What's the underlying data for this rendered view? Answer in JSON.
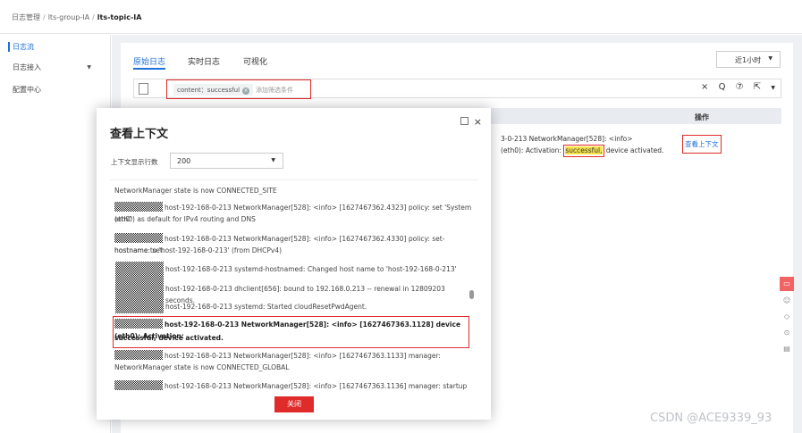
{
  "breadcrumb": {
    "c1": "日志管理",
    "c2": "lts-group-IA",
    "c3": "lts-topic-IA",
    "sep": "/"
  },
  "sidebar": {
    "items": [
      {
        "label": "日志流"
      },
      {
        "label": "日志接入"
      },
      {
        "label": "配置中心"
      }
    ]
  },
  "tabs": [
    {
      "label": "原始日志"
    },
    {
      "label": "实时日志"
    },
    {
      "label": "可视化"
    }
  ],
  "time_select": {
    "value": "近1小时"
  },
  "filter": {
    "chip": "content：successful",
    "add_placeholder": "添加筛选条件",
    "icons": {
      "clear": "×",
      "search": "Q",
      "help": "⑦",
      "export": "⇱"
    }
  },
  "table": {
    "op_header": "操作",
    "log_line1": "3-0-213 NetworkManager[528]: <info>",
    "log_line2_pre": "(eth0): Activation: ",
    "keyword": "successful,",
    "log_line2_post": " device activated.",
    "view_context": "查看上下文"
  },
  "modal": {
    "title": "查看上下文",
    "rows_label": "上下文显示行数",
    "rows_value": "200",
    "close_button": "关闭",
    "close_icon": "×",
    "lines": [
      "NetworkManager state is now CONNECTED_SITE",
      "host-192-168-0-213 NetworkManager[528]: <info> [1627467362.4323] policy: set 'System eth0'",
      "(eth0) as default for IPv4 routing and DNS",
      "host-192-168-0-213 NetworkManager[528]: <info> [1627467362.4330] policy: set-hostname: set",
      "hostname to 'host-192-168-0-213' (from DHCPv4)",
      "host-192-168-0-213 systemd-hostnamed: Changed host name to 'host-192-168-0-213'",
      "host-192-168-0-213 dhclient[656]: bound to 192.168.0.213 -- renewal in 12809203 seconds.",
      "host-192-168-0-213 systemd: Started cloudResetPwdAgent.",
      "host-192-168-0-213 NetworkManager[528]: <info> [1627467363.1128] device (eth0): Activation:",
      "successful, device activated.",
      "host-192-168-0-213 NetworkManager[528]: <info> [1627467363.1133] manager:",
      "NetworkManager state is now CONNECTED_GLOBAL",
      "host-192-168-0-213 NetworkManager[528]: <info> [1627467363.1136] manager: startup"
    ]
  },
  "watermark": "CSDN @ACE9339_93"
}
